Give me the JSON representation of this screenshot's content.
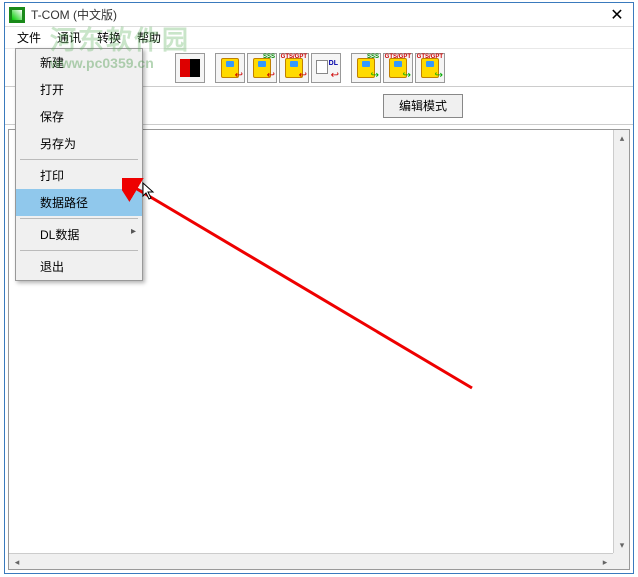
{
  "window": {
    "title": "T-COM (中文版)",
    "close": "✕"
  },
  "menubar": {
    "file": "文件",
    "comm": "通讯",
    "convert": "转换",
    "help": "帮助"
  },
  "toolbar": {
    "open": "打开",
    "flag": "标志",
    "sss1": "SSS",
    "gts1": "GTS/GPT",
    "dl": "DL",
    "sss2": "SSS",
    "gts2": "GTS/GPT",
    "gts3": "GTS/GPT"
  },
  "edit_button": "编辑模式",
  "file_menu": {
    "new": "新建",
    "open": "打开",
    "save": "保存",
    "saveas": "另存为",
    "print": "打印",
    "datapath": "数据路径",
    "dldata": "DL数据",
    "exit": "退出"
  },
  "watermark": {
    "text": "河东软件园",
    "url": "www.pc0359.cn"
  }
}
